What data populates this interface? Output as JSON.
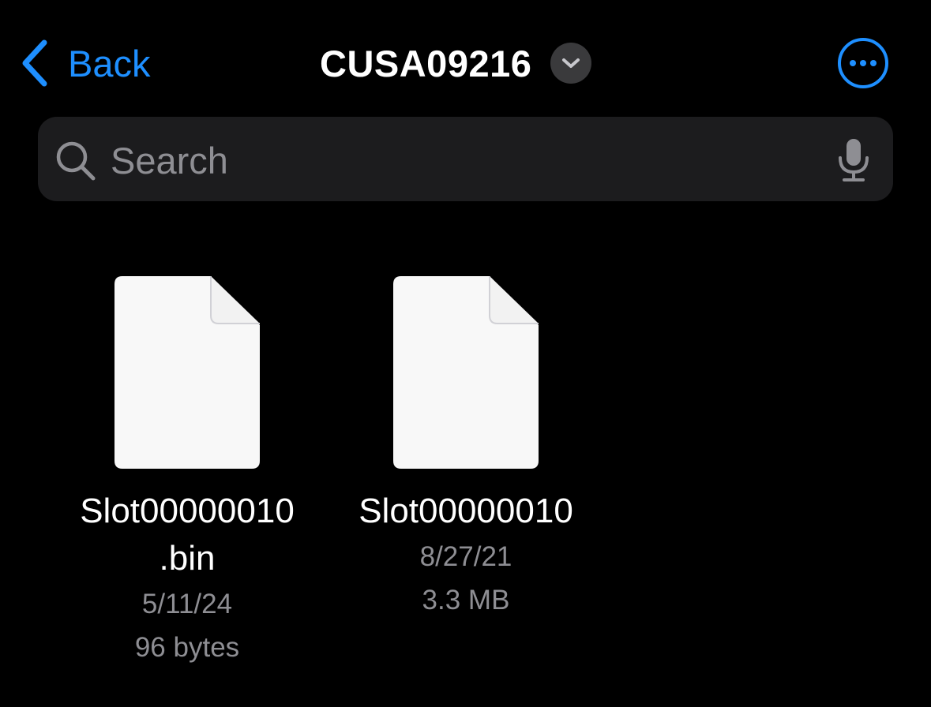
{
  "nav": {
    "back_label": "Back",
    "title": "CUSA09216",
    "icons": {
      "back": "chevron-left-icon",
      "title_menu": "chevron-down-icon",
      "more": "ellipsis-circle-icon"
    },
    "accent_color": "#1e8fff"
  },
  "search": {
    "placeholder": "Search",
    "value": "",
    "icons": {
      "search": "magnifying-glass-icon",
      "dictation": "microphone-icon"
    }
  },
  "files": [
    {
      "name_line1": "Slot00000010",
      "name_line2": ".bin",
      "date": "5/11/24",
      "size": "96 bytes",
      "icon": "document-icon"
    },
    {
      "name_line1": "Slot00000010",
      "name_line2": "",
      "date": "8/27/21",
      "size": "3.3 MB",
      "icon": "document-icon"
    }
  ],
  "colors": {
    "background": "#000000",
    "search_field": "#1c1c1e",
    "secondary_text": "#8e8e93",
    "chevron_circle": "#3a3a3c",
    "document": "#f8f8f8"
  }
}
